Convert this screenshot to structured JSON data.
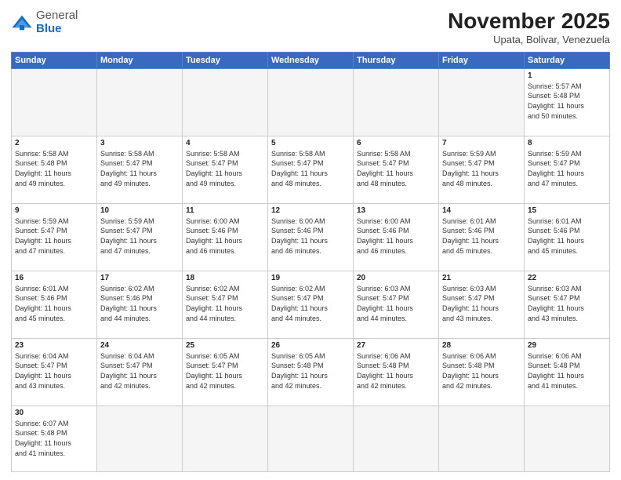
{
  "header": {
    "logo_general": "General",
    "logo_blue": "Blue",
    "month_title": "November 2025",
    "subtitle": "Upata, Bolivar, Venezuela"
  },
  "weekdays": [
    "Sunday",
    "Monday",
    "Tuesday",
    "Wednesday",
    "Thursday",
    "Friday",
    "Saturday"
  ],
  "weeks": [
    [
      {
        "day": "",
        "info": ""
      },
      {
        "day": "",
        "info": ""
      },
      {
        "day": "",
        "info": ""
      },
      {
        "day": "",
        "info": ""
      },
      {
        "day": "",
        "info": ""
      },
      {
        "day": "",
        "info": ""
      },
      {
        "day": "1",
        "info": "Sunrise: 5:57 AM\nSunset: 5:48 PM\nDaylight: 11 hours\nand 50 minutes."
      }
    ],
    [
      {
        "day": "2",
        "info": "Sunrise: 5:58 AM\nSunset: 5:48 PM\nDaylight: 11 hours\nand 49 minutes."
      },
      {
        "day": "3",
        "info": "Sunrise: 5:58 AM\nSunset: 5:47 PM\nDaylight: 11 hours\nand 49 minutes."
      },
      {
        "day": "4",
        "info": "Sunrise: 5:58 AM\nSunset: 5:47 PM\nDaylight: 11 hours\nand 49 minutes."
      },
      {
        "day": "5",
        "info": "Sunrise: 5:58 AM\nSunset: 5:47 PM\nDaylight: 11 hours\nand 48 minutes."
      },
      {
        "day": "6",
        "info": "Sunrise: 5:58 AM\nSunset: 5:47 PM\nDaylight: 11 hours\nand 48 minutes."
      },
      {
        "day": "7",
        "info": "Sunrise: 5:59 AM\nSunset: 5:47 PM\nDaylight: 11 hours\nand 48 minutes."
      },
      {
        "day": "8",
        "info": "Sunrise: 5:59 AM\nSunset: 5:47 PM\nDaylight: 11 hours\nand 47 minutes."
      }
    ],
    [
      {
        "day": "9",
        "info": "Sunrise: 5:59 AM\nSunset: 5:47 PM\nDaylight: 11 hours\nand 47 minutes."
      },
      {
        "day": "10",
        "info": "Sunrise: 5:59 AM\nSunset: 5:47 PM\nDaylight: 11 hours\nand 47 minutes."
      },
      {
        "day": "11",
        "info": "Sunrise: 6:00 AM\nSunset: 5:46 PM\nDaylight: 11 hours\nand 46 minutes."
      },
      {
        "day": "12",
        "info": "Sunrise: 6:00 AM\nSunset: 5:46 PM\nDaylight: 11 hours\nand 46 minutes."
      },
      {
        "day": "13",
        "info": "Sunrise: 6:00 AM\nSunset: 5:46 PM\nDaylight: 11 hours\nand 46 minutes."
      },
      {
        "day": "14",
        "info": "Sunrise: 6:01 AM\nSunset: 5:46 PM\nDaylight: 11 hours\nand 45 minutes."
      },
      {
        "day": "15",
        "info": "Sunrise: 6:01 AM\nSunset: 5:46 PM\nDaylight: 11 hours\nand 45 minutes."
      }
    ],
    [
      {
        "day": "16",
        "info": "Sunrise: 6:01 AM\nSunset: 5:46 PM\nDaylight: 11 hours\nand 45 minutes."
      },
      {
        "day": "17",
        "info": "Sunrise: 6:02 AM\nSunset: 5:46 PM\nDaylight: 11 hours\nand 44 minutes."
      },
      {
        "day": "18",
        "info": "Sunrise: 6:02 AM\nSunset: 5:47 PM\nDaylight: 11 hours\nand 44 minutes."
      },
      {
        "day": "19",
        "info": "Sunrise: 6:02 AM\nSunset: 5:47 PM\nDaylight: 11 hours\nand 44 minutes."
      },
      {
        "day": "20",
        "info": "Sunrise: 6:03 AM\nSunset: 5:47 PM\nDaylight: 11 hours\nand 44 minutes."
      },
      {
        "day": "21",
        "info": "Sunrise: 6:03 AM\nSunset: 5:47 PM\nDaylight: 11 hours\nand 43 minutes."
      },
      {
        "day": "22",
        "info": "Sunrise: 6:03 AM\nSunset: 5:47 PM\nDaylight: 11 hours\nand 43 minutes."
      }
    ],
    [
      {
        "day": "23",
        "info": "Sunrise: 6:04 AM\nSunset: 5:47 PM\nDaylight: 11 hours\nand 43 minutes."
      },
      {
        "day": "24",
        "info": "Sunrise: 6:04 AM\nSunset: 5:47 PM\nDaylight: 11 hours\nand 42 minutes."
      },
      {
        "day": "25",
        "info": "Sunrise: 6:05 AM\nSunset: 5:47 PM\nDaylight: 11 hours\nand 42 minutes."
      },
      {
        "day": "26",
        "info": "Sunrise: 6:05 AM\nSunset: 5:48 PM\nDaylight: 11 hours\nand 42 minutes."
      },
      {
        "day": "27",
        "info": "Sunrise: 6:06 AM\nSunset: 5:48 PM\nDaylight: 11 hours\nand 42 minutes."
      },
      {
        "day": "28",
        "info": "Sunrise: 6:06 AM\nSunset: 5:48 PM\nDaylight: 11 hours\nand 42 minutes."
      },
      {
        "day": "29",
        "info": "Sunrise: 6:06 AM\nSunset: 5:48 PM\nDaylight: 11 hours\nand 41 minutes."
      }
    ],
    [
      {
        "day": "30",
        "info": "Sunrise: 6:07 AM\nSunset: 5:48 PM\nDaylight: 11 hours\nand 41 minutes."
      },
      {
        "day": "",
        "info": ""
      },
      {
        "day": "",
        "info": ""
      },
      {
        "day": "",
        "info": ""
      },
      {
        "day": "",
        "info": ""
      },
      {
        "day": "",
        "info": ""
      },
      {
        "day": "",
        "info": ""
      }
    ]
  ]
}
